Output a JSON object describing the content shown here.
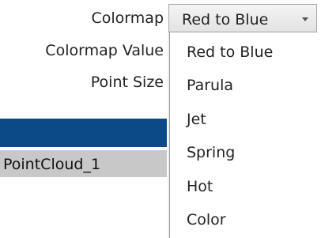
{
  "properties": {
    "colormap_label": "Colormap",
    "colormap_value_label": "Colormap Value",
    "point_size_label": "Point Size"
  },
  "colormap_select": {
    "selected": "Red to Blue",
    "options": [
      "Red to Blue",
      "Parula",
      "Jet",
      "Spring",
      "Hot",
      "Color"
    ]
  },
  "tree": {
    "item_label": "PointCloud_1"
  },
  "colors": {
    "selection_blue": "#0b4a86",
    "row_gray": "#c8c8c8"
  },
  "icons": {
    "dropdown": "chevron-down-icon"
  }
}
